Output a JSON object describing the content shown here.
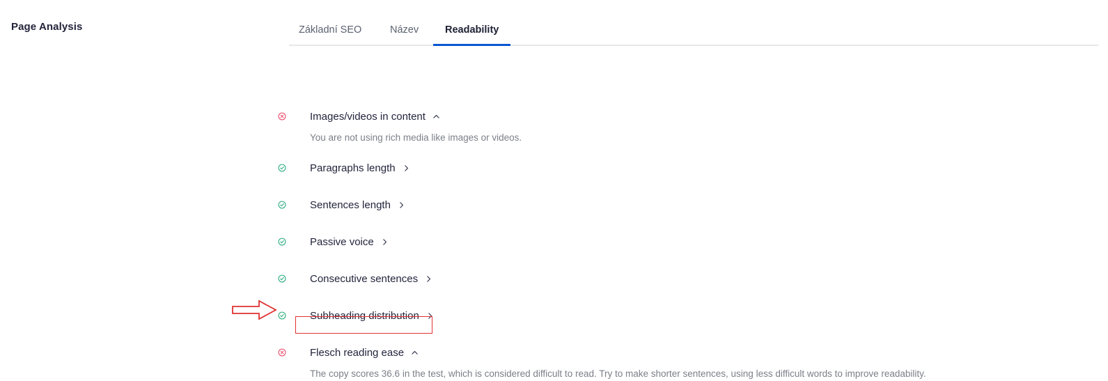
{
  "page": {
    "title": "Page Analysis"
  },
  "tabs": [
    {
      "id": "zakladni-seo",
      "label": "Základní SEO",
      "active": false
    },
    {
      "id": "nazev",
      "label": "Název",
      "active": false
    },
    {
      "id": "readability",
      "label": "Readability",
      "active": true
    }
  ],
  "checklist": [
    {
      "id": "images",
      "label": "Images/videos in content",
      "status": "bad",
      "status_icon": "circle-x-icon",
      "expanded": true,
      "toggle_icon": "chevron-up-icon",
      "description": "You are not using rich media like images or videos."
    },
    {
      "id": "paragraphs",
      "label": "Paragraphs length",
      "status": "good",
      "status_icon": "circle-check-icon",
      "expanded": false,
      "toggle_icon": "chevron-right-icon",
      "description": ""
    },
    {
      "id": "sentences",
      "label": "Sentences length",
      "status": "good",
      "status_icon": "circle-check-icon",
      "expanded": false,
      "toggle_icon": "chevron-right-icon",
      "description": ""
    },
    {
      "id": "passive",
      "label": "Passive voice",
      "status": "good",
      "status_icon": "circle-check-icon",
      "expanded": false,
      "toggle_icon": "chevron-right-icon",
      "description": ""
    },
    {
      "id": "consecutive",
      "label": "Consecutive sentences",
      "status": "good",
      "status_icon": "circle-check-icon",
      "expanded": false,
      "toggle_icon": "chevron-right-icon",
      "description": ""
    },
    {
      "id": "subheading",
      "label": "Subheading distribution",
      "status": "good",
      "status_icon": "circle-check-icon",
      "expanded": false,
      "toggle_icon": "chevron-right-icon",
      "description": ""
    },
    {
      "id": "flesch",
      "label": "Flesch reading ease",
      "status": "bad",
      "status_icon": "circle-x-icon",
      "expanded": true,
      "toggle_icon": "chevron-up-icon",
      "description": "The copy scores 36.6 in the test, which is considered difficult to read. Try to make shorter sentences, using less difficult words to improve readability."
    }
  ],
  "annotations": {
    "arrow_icon": "right-arrow-annotation",
    "arrow_color": "#e03131",
    "highlight_box_color": "#e03131",
    "highlighted_text": "The copy scores 36.6 in the test,"
  },
  "colors": {
    "accent_blue": "#0b57d0",
    "status_good": "#17a673",
    "status_bad": "#e8385c",
    "text_primary": "#22253c",
    "text_muted": "#7b7f88",
    "divider": "#e8e8e8"
  }
}
